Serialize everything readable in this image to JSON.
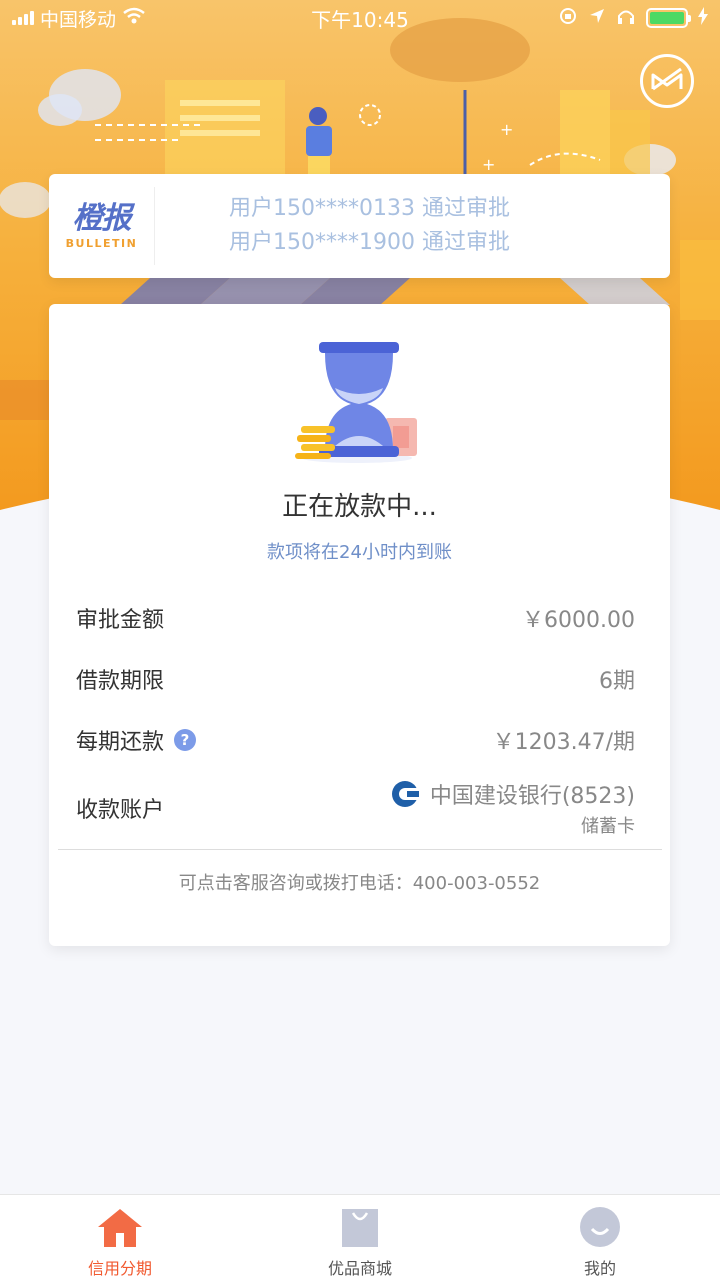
{
  "status_bar": {
    "carrier": "中国移动",
    "time": "下午10:45"
  },
  "bulletin": {
    "brand_cn": "橙报",
    "brand_en": "BULLETIN",
    "items": [
      "用户150****0133 通过审批",
      "用户150****1900 通过审批"
    ]
  },
  "loan": {
    "status_title": "正在放款中...",
    "status_sub": "款项将在24小时内到账",
    "rows": [
      {
        "label": "审批金额",
        "value": "￥6000.00"
      },
      {
        "label": "借款期限",
        "value": "6期"
      },
      {
        "label": "每期还款",
        "value": "￥1203.47/期"
      }
    ],
    "account_label": "收款账户",
    "bank_name": "中国建设银行(8523)",
    "card_type": "储蓄卡",
    "help_icon": "?",
    "hotline": "可点击客服咨询或拨打电话：400-003-0552"
  },
  "tabs": [
    {
      "label": "信用分期",
      "icon": "home-icon",
      "active": true
    },
    {
      "label": "优品商城",
      "icon": "shopping-bag-icon",
      "active": false
    },
    {
      "label": "我的",
      "icon": "profile-icon",
      "active": false
    }
  ],
  "colors": {
    "accent": "#f15a30",
    "hero": "#f5a623",
    "link": "#6f8fc8"
  }
}
